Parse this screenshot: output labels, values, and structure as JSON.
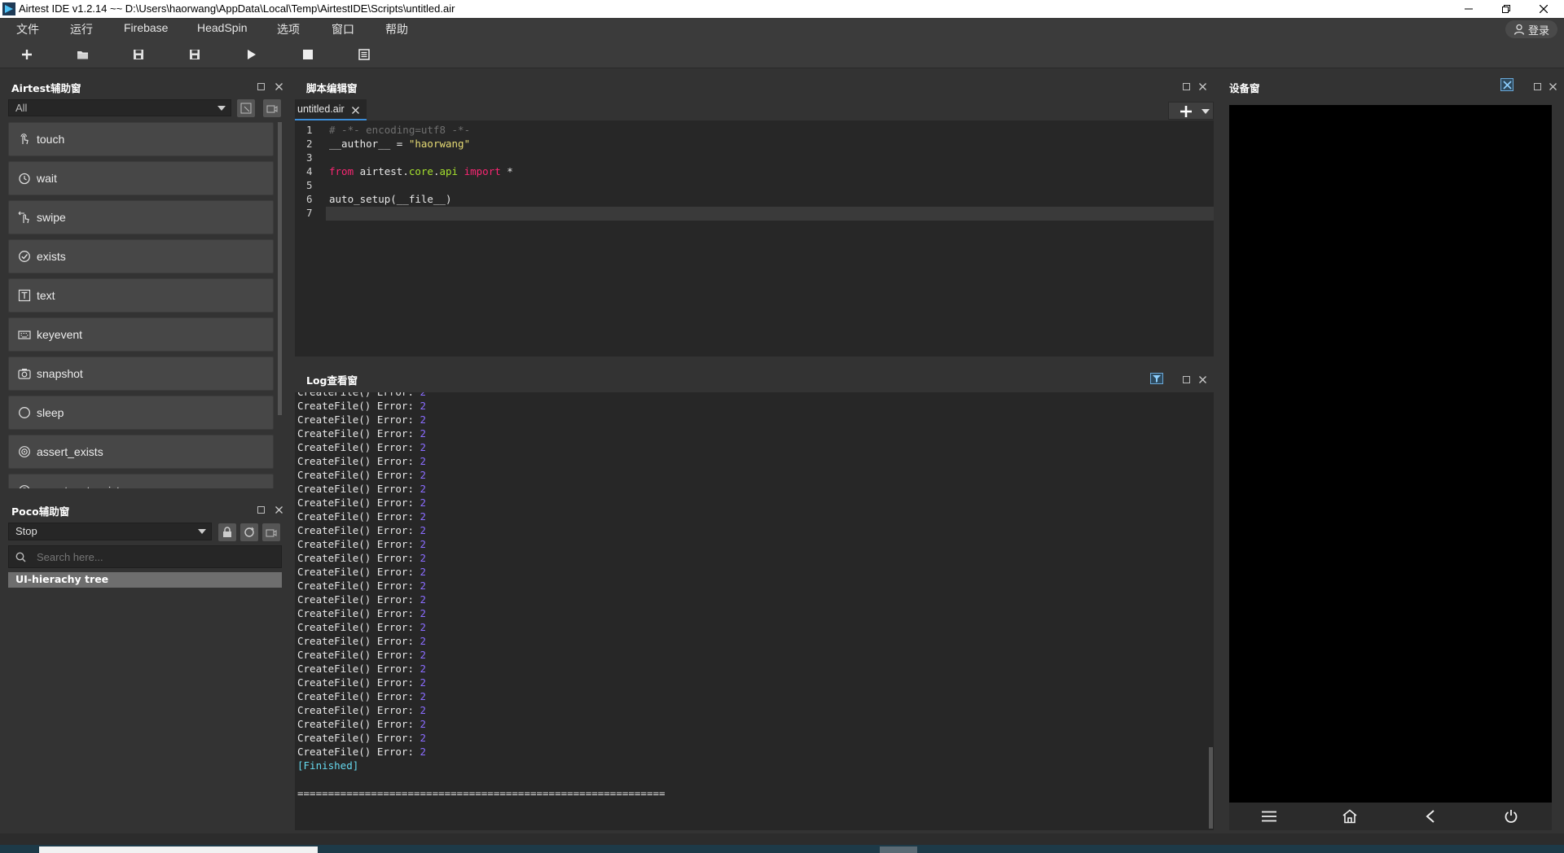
{
  "window": {
    "title": "Airtest IDE v1.2.14 ~~ D:\\Users\\haorwang\\AppData\\Local\\Temp\\AirtestIDE\\Scripts\\untitled.air"
  },
  "menu": [
    "文件",
    "运行",
    "Firebase",
    "HeadSpin",
    "选项",
    "窗口",
    "帮助"
  ],
  "login_label": "登录",
  "toolbar_icons": [
    "new-file-icon",
    "open-folder-icon",
    "save-icon",
    "save-as-icon",
    "run-icon",
    "stop-icon",
    "log-view-icon"
  ],
  "airtest_panel": {
    "title": "Airtest辅助窗",
    "filter_value": "All",
    "apis": [
      {
        "label": "touch",
        "icon": "touch-icon"
      },
      {
        "label": "wait",
        "icon": "clock-icon"
      },
      {
        "label": "swipe",
        "icon": "swipe-icon"
      },
      {
        "label": "exists",
        "icon": "check-circle-icon"
      },
      {
        "label": "text",
        "icon": "text-icon"
      },
      {
        "label": "keyevent",
        "icon": "keyboard-icon"
      },
      {
        "label": "snapshot",
        "icon": "camera-icon"
      },
      {
        "label": "sleep",
        "icon": "moon-icon"
      },
      {
        "label": "assert_exists",
        "icon": "target-icon"
      },
      {
        "label": "assert_not_exists",
        "icon": "target-icon"
      }
    ]
  },
  "poco_panel": {
    "title": "Poco辅助窗",
    "mode_value": "Stop",
    "search_placeholder": "Search here...",
    "tree_label": "UI-hierachy tree"
  },
  "editor_panel": {
    "title": "脚本编辑窗",
    "tab_label": "untitled.air",
    "lines": [
      {
        "n": "1",
        "parts": [
          {
            "t": "# -*- encoding=utf8 -*-",
            "c": "c-comment"
          }
        ]
      },
      {
        "n": "2",
        "parts": [
          {
            "t": "__author__ = ",
            "c": ""
          },
          {
            "t": "\"haorwang\"",
            "c": "c-str"
          }
        ]
      },
      {
        "n": "3",
        "parts": []
      },
      {
        "n": "4",
        "parts": [
          {
            "t": "from",
            "c": "c-kw"
          },
          {
            "t": " airtest.",
            "c": ""
          },
          {
            "t": "core",
            "c": "c-mod"
          },
          {
            "t": ".",
            "c": ""
          },
          {
            "t": "api",
            "c": "c-mod"
          },
          {
            "t": " ",
            "c": ""
          },
          {
            "t": "import",
            "c": "c-kw"
          },
          {
            "t": " *",
            "c": ""
          }
        ]
      },
      {
        "n": "5",
        "parts": []
      },
      {
        "n": "6",
        "parts": [
          {
            "t": "auto_setup(__file__)",
            "c": ""
          }
        ]
      },
      {
        "n": "7",
        "parts": []
      }
    ]
  },
  "log_panel": {
    "title": "Log查看窗",
    "error_text": "CreateFile() Error: ",
    "error_code": "2",
    "error_count": 27,
    "finished": "[Finished]",
    "separator": "============================================================"
  },
  "device_panel": {
    "title": "设备窗",
    "nav_icons": [
      "menu-icon",
      "home-icon",
      "back-icon",
      "power-icon"
    ]
  }
}
